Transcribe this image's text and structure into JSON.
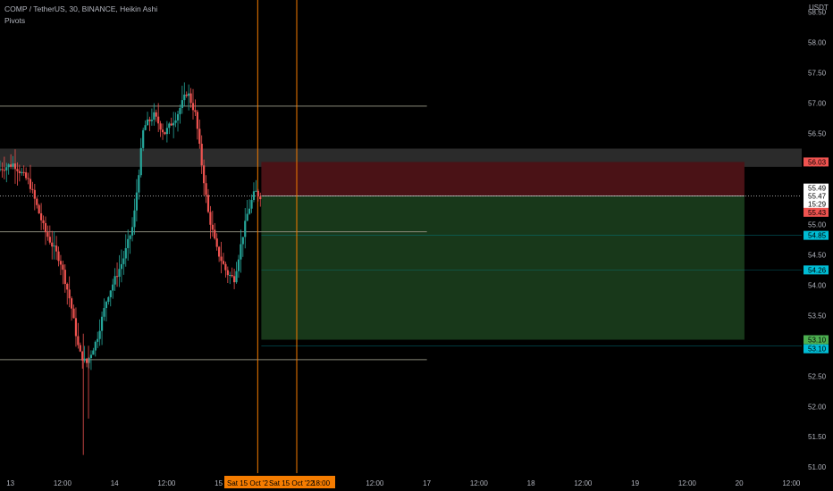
{
  "header": {
    "symbol_line": "COMP / TetherUS, 30, BINANCE, Heikin Ashi",
    "indicator": "Pivots"
  },
  "colors": {
    "background": "#000000",
    "up": "#26a69a",
    "down": "#ef5350",
    "pivot_line": "#8a8a7a",
    "vline": "#f57c00",
    "stop_zone": "#4a1216",
    "target_zone": "#18381a",
    "resistance_band": "#3a3a3a"
  },
  "chart_data": {
    "type": "candlestick",
    "title": "COMP / TetherUS, 30, BINANCE, Heikin Ashi",
    "currency": "USDT",
    "y_ticks": [
      "58.50",
      "58.00",
      "57.50",
      "57.00",
      "56.50",
      "56.00",
      "55.50",
      "55.00",
      "54.50",
      "54.00",
      "53.50",
      "53.00",
      "52.50",
      "52.00",
      "51.50",
      "51.00"
    ],
    "ylim": [
      50.9,
      58.7
    ],
    "x_ticks": [
      "13",
      "12:00",
      "14",
      "12:00",
      "15",
      "12:00",
      "Sat 15 Oct '22",
      "18:00",
      "12:00",
      "17",
      "12:00",
      "18",
      "12:00",
      "19",
      "12:00",
      "20",
      "12:00"
    ],
    "x_tick_values": [
      13.0,
      13.5,
      14.0,
      14.5,
      15.0,
      15.5,
      15.6,
      15.75,
      16.5,
      17.0,
      17.5,
      18.0,
      18.5,
      19.0,
      19.5,
      20.0,
      20.5
    ],
    "crosshair_time_labels": [
      "Sat 15 Oct '2",
      "Sat 15 Oct '22",
      "18:00"
    ],
    "xlim": [
      12.9,
      20.6
    ],
    "vertical_lines_x": [
      15.375,
      15.75
    ],
    "pivot_levels": [
      {
        "value": 56.95,
        "x_end": 17.0
      },
      {
        "value": 54.88,
        "x_end": 17.0
      },
      {
        "value": 52.77,
        "x_end": 17.0
      }
    ],
    "resistance_band": {
      "low": 55.95,
      "high": 56.25
    },
    "position": {
      "x_start": 15.41,
      "x_end": 20.05,
      "entry": 55.47,
      "stop": 56.03,
      "target": 53.1
    },
    "price_labels": [
      {
        "text": "56.03",
        "value": 56.03,
        "bg": "#ef5350",
        "fg": "#000000"
      },
      {
        "text": "55.49",
        "value": 55.6,
        "bg": "#ffffff",
        "fg": "#000000"
      },
      {
        "text": "55.47",
        "value": 55.47,
        "bg": "#ffffff",
        "fg": "#000000"
      },
      {
        "text": "15:29",
        "value": 55.34,
        "bg": "#ffffff",
        "fg": "#000000"
      },
      {
        "text": "55.43",
        "value": 55.2,
        "bg": "#ef5350",
        "fg": "#000000"
      },
      {
        "text": "54.85",
        "value": 54.82,
        "bg": "#00bcd4",
        "fg": "#000000"
      },
      {
        "text": "54.26",
        "value": 54.25,
        "bg": "#00bcd4",
        "fg": "#000000"
      },
      {
        "text": "53.10",
        "value": 53.1,
        "bg": "#4caf50",
        "fg": "#000000"
      },
      {
        "text": "53.10",
        "value": 52.95,
        "bg": "#00bcd4",
        "fg": "#000000"
      }
    ],
    "path_points": [
      [
        12.9,
        55.9
      ],
      [
        13.05,
        56.0
      ],
      [
        13.2,
        55.7
      ],
      [
        13.35,
        54.9
      ],
      [
        13.5,
        54.4
      ],
      [
        13.6,
        53.7
      ],
      [
        13.68,
        52.9
      ],
      [
        13.75,
        52.7
      ],
      [
        13.85,
        53.1
      ],
      [
        13.95,
        53.8
      ],
      [
        14.1,
        54.4
      ],
      [
        14.2,
        55.0
      ],
      [
        14.3,
        56.6
      ],
      [
        14.4,
        56.8
      ],
      [
        14.5,
        56.5
      ],
      [
        14.62,
        56.8
      ],
      [
        14.72,
        57.2
      ],
      [
        14.8,
        56.8
      ],
      [
        14.85,
        56.1
      ],
      [
        14.92,
        55.2
      ],
      [
        15.0,
        54.6
      ],
      [
        15.1,
        54.2
      ],
      [
        15.17,
        54.1
      ],
      [
        15.25,
        54.8
      ],
      [
        15.3,
        55.2
      ],
      [
        15.37,
        55.55
      ],
      [
        15.41,
        55.47
      ]
    ]
  }
}
